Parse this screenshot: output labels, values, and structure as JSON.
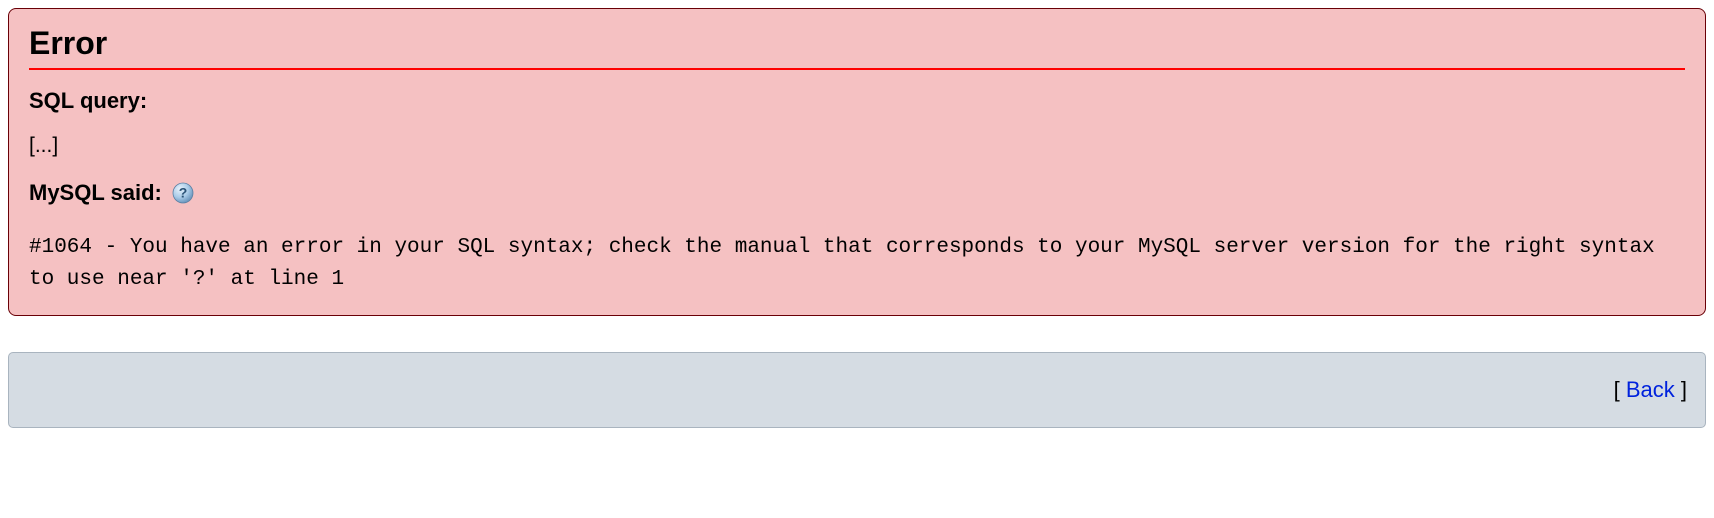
{
  "error": {
    "title": "Error",
    "sql_query_label": "SQL query:",
    "sql_query_content": "[...]",
    "mysql_said_label": "MySQL said:",
    "message": "#1064 - You have an error in your SQL syntax; check the manual that corresponds to your MySQL server version for the right syntax to use near '?' at line 1"
  },
  "footer": {
    "bracket_open": "[ ",
    "back_label": "Back",
    "bracket_close": " ]"
  }
}
